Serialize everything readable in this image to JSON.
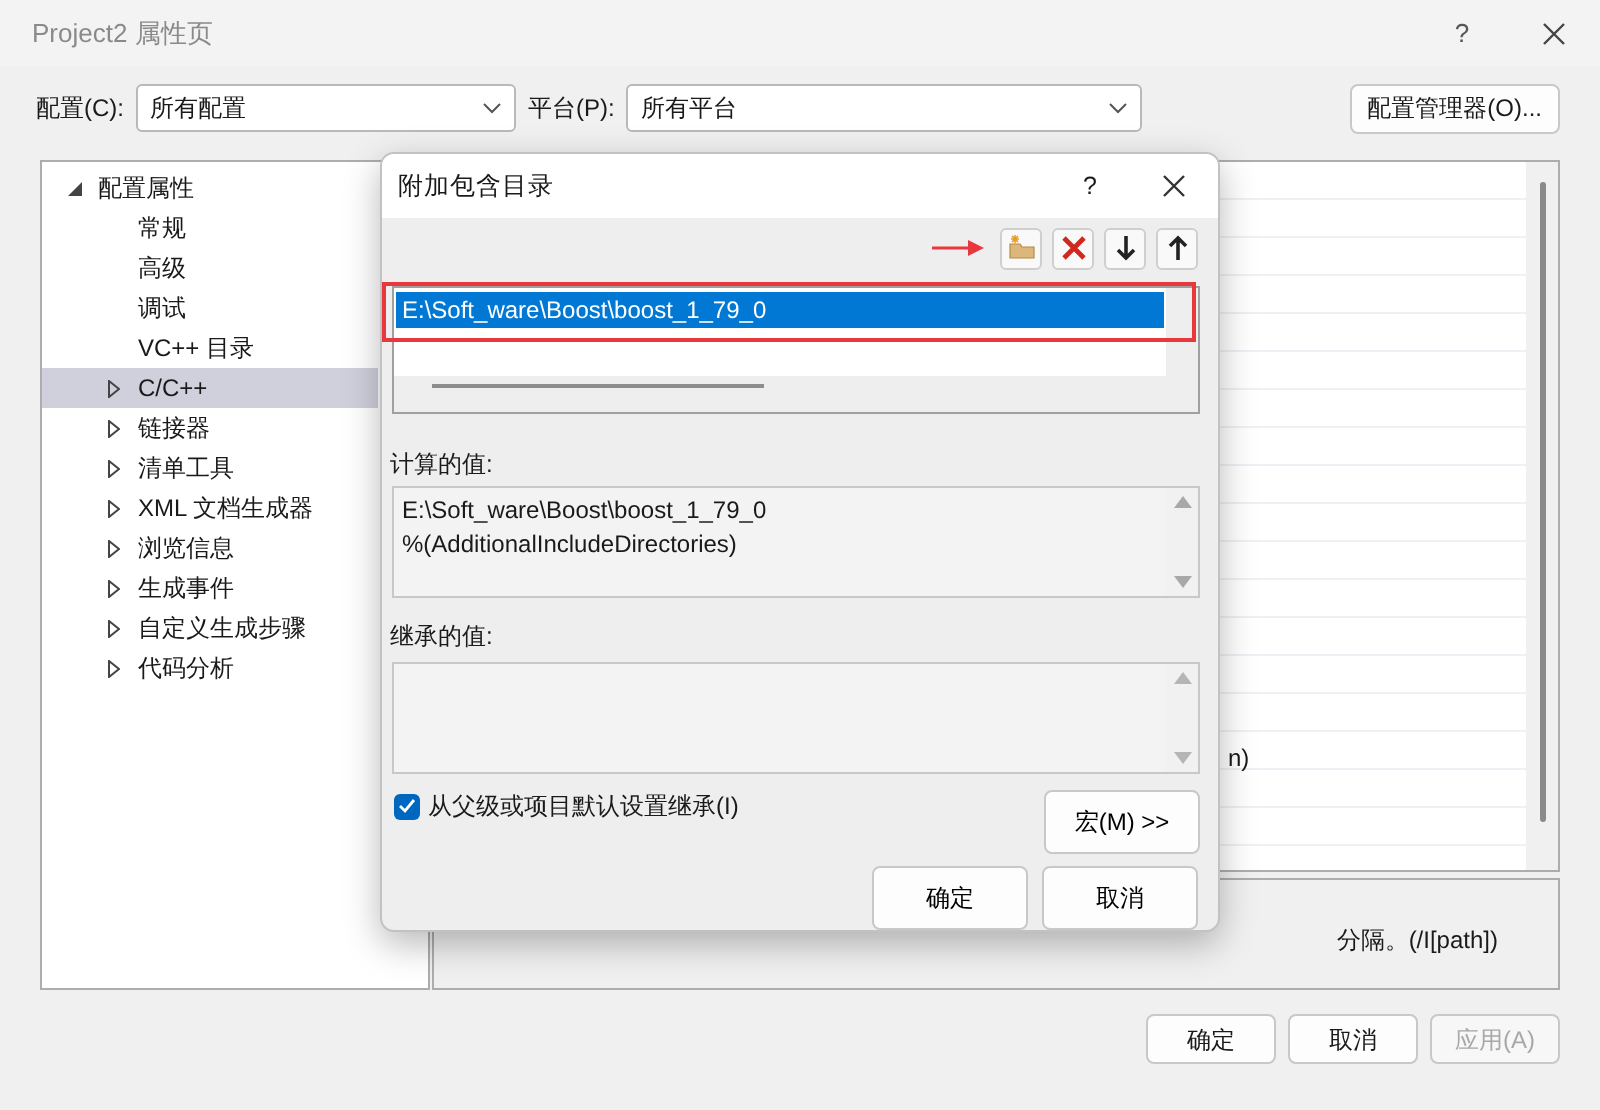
{
  "window": {
    "title": "Project2 属性页",
    "help": "?"
  },
  "toolbar": {
    "config_label": "配置(C):",
    "config_value": "所有配置",
    "platform_label": "平台(P):",
    "platform_value": "所有平台",
    "manager_button": "配置管理器(O)..."
  },
  "tree": [
    {
      "label": "配置属性",
      "kind": "group",
      "expanded": true,
      "selected": false,
      "children": [
        {
          "label": "常规",
          "kind": "leaf",
          "selected": false
        },
        {
          "label": "高级",
          "kind": "leaf",
          "selected": false
        },
        {
          "label": "调试",
          "kind": "leaf",
          "selected": false
        },
        {
          "label": "VC++ 目录",
          "kind": "leaf",
          "selected": false
        },
        {
          "label": "C/C++",
          "kind": "group",
          "expanded": false,
          "selected": true
        },
        {
          "label": "链接器",
          "kind": "group",
          "expanded": false,
          "selected": false
        },
        {
          "label": "清单工具",
          "kind": "group",
          "expanded": false,
          "selected": false
        },
        {
          "label": "XML 文档生成器",
          "kind": "group",
          "expanded": false,
          "selected": false
        },
        {
          "label": "浏览信息",
          "kind": "group",
          "expanded": false,
          "selected": false
        },
        {
          "label": "生成事件",
          "kind": "group",
          "expanded": false,
          "selected": false
        },
        {
          "label": "自定义生成步骤",
          "kind": "group",
          "expanded": false,
          "selected": false
        },
        {
          "label": "代码分析",
          "kind": "group",
          "expanded": false,
          "selected": false
        }
      ]
    }
  ],
  "property_grid": {
    "visible_fragment": "n)"
  },
  "description": "分隔。(/I[path])",
  "buttons": [
    {
      "label": "确定",
      "disabled": false
    },
    {
      "label": "取消",
      "disabled": false
    },
    {
      "label": "应用(A)",
      "disabled": true
    }
  ],
  "dialog": {
    "title": "附加包含目录",
    "help": "?",
    "tools": [
      {
        "kind": "new-folder"
      },
      {
        "kind": "delete"
      },
      {
        "kind": "move-down"
      },
      {
        "kind": "move-up"
      }
    ],
    "directories": [
      {
        "text": "E:\\Soft_ware\\Boost\\boost_1_79_0",
        "selected": true
      }
    ],
    "computed_label": "计算的值:",
    "computed_lines": [
      "E:\\Soft_ware\\Boost\\boost_1_79_0",
      "%(AdditionalIncludeDirectories)"
    ],
    "inherited_label": "继承的值:",
    "inherit": {
      "label": "从父级或项目默认设置继承(I)",
      "checked": true
    },
    "macro_button": "宏(M) >>",
    "ok": "确定",
    "cancel": "取消"
  }
}
